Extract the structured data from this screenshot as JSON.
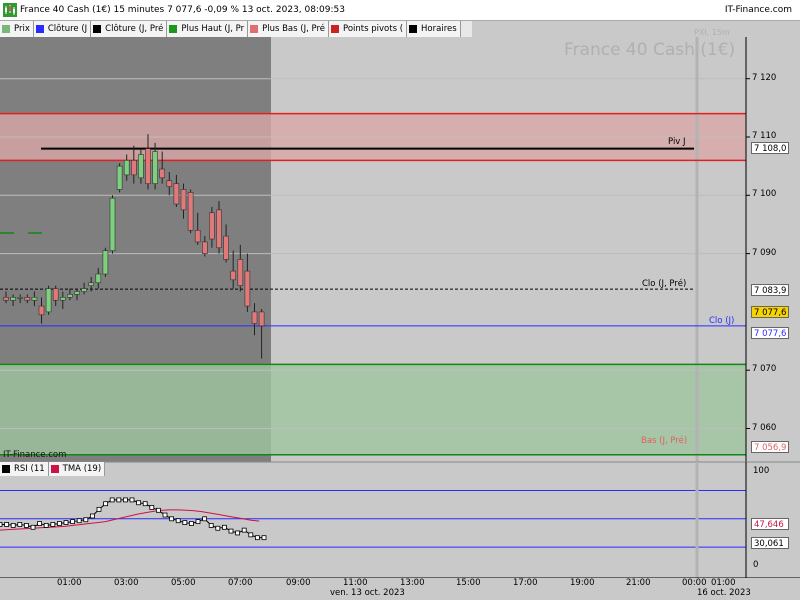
{
  "title_bar": {
    "title": "France 40 Cash (1€) 15 minutes 7 077,6 -0,09 % 13 oct. 2023, 08:09:53",
    "brand": "IT-Finance.com"
  },
  "legend": [
    {
      "label": "Prix",
      "color": "#7ab87a"
    },
    {
      "label": "Clôture (J",
      "color": "#2b2bff"
    },
    {
      "label": "Clôture (J, Pré",
      "color": "#000000"
    },
    {
      "label": "Plus Haut (J, Pr",
      "color": "#1a9a1a"
    },
    {
      "label": "Plus Bas (J, Pré",
      "color": "#e07070"
    },
    {
      "label": "Points pivots (",
      "color": "#cc2222"
    },
    {
      "label": "Horaires",
      "color": "#000000"
    }
  ],
  "watermark": {
    "title": "France 40 Cash (1€)",
    "sub": "PXI, 15m"
  },
  "logo_text": "IT-Finance.com",
  "colors": {
    "background": "#c9c9c9",
    "session_shade": "#7f7f7f",
    "bull": "#7ed07e",
    "bear": "#e07a7a",
    "resistance_zone": "#d9a8a8",
    "support_zone": "#9fc69f",
    "rsi_line": "#000000",
    "tma_line": "#cc1144",
    "last_price_tag": "#f6d400",
    "clo_j": "#2b2bff",
    "bas_j": "#e06060"
  },
  "price_axis": {
    "ticks": [
      "7 120",
      "7 110",
      "7 100",
      "7 090",
      "7 070",
      "7 060"
    ],
    "tags": {
      "piv": "7 108,0",
      "clo_pre": "7 083,9",
      "last": "7 077,6",
      "clo_j": "7 077,6",
      "bas": "7 056,9"
    }
  },
  "annotations": {
    "piv": "Piv J",
    "clo_pre": "Clo (J, Pré)",
    "clo_j": "Clo (J)",
    "bas": "Bas (J, Pré)"
  },
  "rsi_panel": {
    "legend": [
      {
        "label": "RSI (11",
        "color": "#000000"
      },
      {
        "label": "TMA (19)",
        "color": "#cc1144"
      }
    ],
    "ticks": [
      "100",
      "0"
    ],
    "tags": {
      "tma": "47,646",
      "rsi": "30,061"
    }
  },
  "time_axis": {
    "labels": [
      "01:00",
      "03:00",
      "05:00",
      "07:00",
      "09:00",
      "11:00",
      "13:00",
      "15:00",
      "17:00",
      "19:00",
      "21:00",
      "00:00",
      "01:00"
    ],
    "dates": [
      "ven. 13 oct. 2023",
      "16 oct. 2023"
    ]
  },
  "chart_data": [
    {
      "type": "candlestick",
      "title": "France 40 Cash (1€)",
      "interval": "15 minutes",
      "y_range": [
        7052,
        7130
      ],
      "levels": {
        "piv_j": 7108.0,
        "clo_j_pre": 7083.9,
        "clo_j": 7077.6,
        "bas_j_pre": 7056.9,
        "resistance_zone": [
          7106,
          7114
        ],
        "support_zone": [
          7055.5,
          7071
        ]
      },
      "ohlc": [
        [
          7082.5,
          7083.5,
          7081.5,
          7082.0
        ],
        [
          7082.0,
          7083.0,
          7081.0,
          7082.5
        ],
        [
          7082.5,
          7083.0,
          7081.5,
          7082.5
        ],
        [
          7082.5,
          7083.0,
          7081.5,
          7082.0
        ],
        [
          7082.0,
          7083.5,
          7081.0,
          7082.5
        ],
        [
          7081.0,
          7082.5,
          7078.0,
          7079.5
        ],
        [
          7080.0,
          7084.5,
          7079.5,
          7084.0
        ],
        [
          7084.0,
          7084.5,
          7081.0,
          7082.0
        ],
        [
          7082.0,
          7083.5,
          7080.5,
          7082.5
        ],
        [
          7082.5,
          7084.0,
          7082.0,
          7083.0
        ],
        [
          7083.0,
          7084.0,
          7082.0,
          7083.5
        ],
        [
          7083.5,
          7085.0,
          7083.0,
          7084.0
        ],
        [
          7084.5,
          7086.0,
          7083.5,
          7085.0
        ],
        [
          7085.0,
          7087.5,
          7084.0,
          7086.5
        ],
        [
          7086.5,
          7091.0,
          7086.0,
          7090.5
        ],
        [
          7090.5,
          7100.0,
          7090.0,
          7099.5
        ],
        [
          7101.0,
          7105.5,
          7100.5,
          7105.0
        ],
        [
          7103.5,
          7107.0,
          7102.5,
          7106.0
        ],
        [
          7106.0,
          7108.5,
          7102.0,
          7103.5
        ],
        [
          7103.0,
          7108.0,
          7102.0,
          7107.0
        ],
        [
          7108.0,
          7110.5,
          7101.0,
          7102.0
        ],
        [
          7102.0,
          7109.0,
          7101.0,
          7107.5
        ],
        [
          7104.5,
          7107.5,
          7102.0,
          7103.0
        ],
        [
          7102.5,
          7104.0,
          7100.0,
          7101.5
        ],
        [
          7102.0,
          7103.5,
          7098.0,
          7098.5
        ],
        [
          7101.0,
          7102.0,
          7096.0,
          7097.5
        ],
        [
          7100.5,
          7101.0,
          7093.5,
          7094.0
        ],
        [
          7094.0,
          7097.0,
          7091.5,
          7092.0
        ],
        [
          7092.0,
          7093.0,
          7089.5,
          7090.0
        ],
        [
          7097.0,
          7098.0,
          7091.0,
          7092.5
        ],
        [
          7097.5,
          7099.0,
          7090.0,
          7091.0
        ],
        [
          7093.0,
          7095.0,
          7088.5,
          7089.0
        ],
        [
          7087.0,
          7090.5,
          7084.0,
          7085.5
        ],
        [
          7089.0,
          7091.5,
          7083.5,
          7084.5
        ],
        [
          7087.0,
          7090.0,
          7080.0,
          7081.0
        ],
        [
          7080.0,
          7081.5,
          7076.0,
          7078.0
        ],
        [
          7080.0,
          7080.5,
          7072.0,
          7077.6
        ]
      ]
    },
    {
      "type": "line",
      "title": "RSI (11) / TMA (19)",
      "y_range": [
        0,
        100
      ],
      "levels": [
        80,
        50,
        20
      ],
      "series": [
        {
          "name": "RSI (11",
          "values": [
            44,
            44,
            43,
            44,
            43,
            41,
            45,
            43,
            44,
            45,
            46,
            47,
            48,
            49,
            53,
            60,
            66,
            70,
            70,
            70,
            70,
            67,
            66,
            62,
            59,
            54,
            50,
            48,
            46,
            45,
            47,
            50,
            43,
            40,
            41,
            37,
            35,
            38,
            33,
            30,
            30
          ]
        },
        {
          "name": "TMA (19)",
          "values": [
            38,
            38.5,
            39,
            39.5,
            40,
            40.5,
            41,
            41.5,
            42,
            43,
            44,
            45,
            46,
            47,
            49,
            51,
            53,
            55,
            56.5,
            58,
            59,
            59.5,
            59.5,
            59,
            58.5,
            57.5,
            56,
            54.5,
            53,
            51.5,
            50,
            48.5,
            47.6
          ]
        }
      ],
      "last_values": {
        "TMA (19)": 47.646,
        "RSI (11": 30.061
      }
    }
  ]
}
